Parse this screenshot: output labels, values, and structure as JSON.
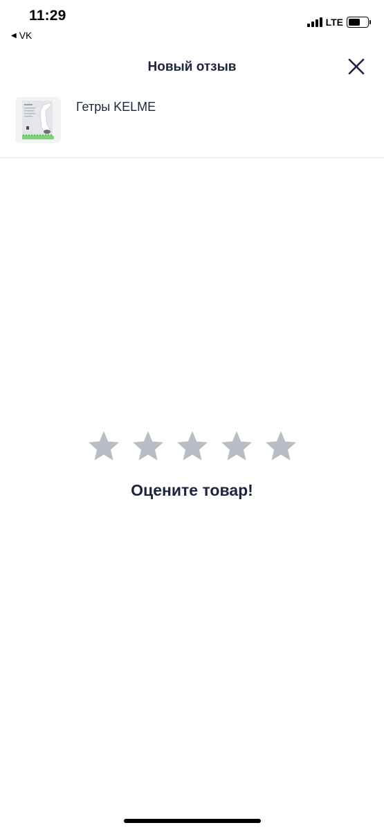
{
  "status_bar": {
    "time": "11:29",
    "back_app_label": "VK",
    "back_app_icon": "back-triangle-icon",
    "network": "LTE",
    "battery_level_percent": 60
  },
  "header": {
    "title": "Новый отзыв",
    "close_icon": "close-icon"
  },
  "product": {
    "name": "Гетры KELME",
    "thumbnail_icon": "product-image"
  },
  "rating": {
    "stars_total": 5,
    "selected": 0,
    "prompt": "Оцените товар!",
    "star_color": "#b7bcc6"
  },
  "colors": {
    "text_primary": "#1c2540",
    "divider": "#e3e5ea",
    "background": "#ffffff"
  }
}
